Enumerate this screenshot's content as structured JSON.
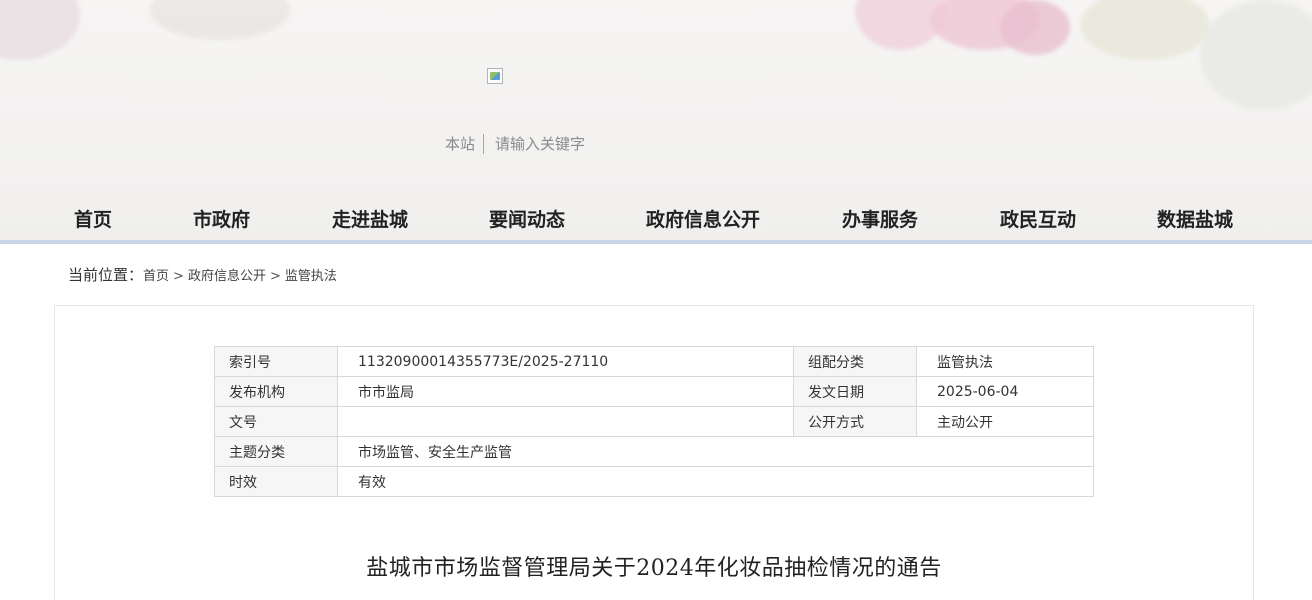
{
  "header": {
    "search_scope": "本站",
    "search_placeholder": "请输入关键字"
  },
  "nav": {
    "items": [
      {
        "label": "首页"
      },
      {
        "label": "市政府"
      },
      {
        "label": "走进盐城"
      },
      {
        "label": "要闻动态"
      },
      {
        "label": "政府信息公开"
      },
      {
        "label": "办事服务"
      },
      {
        "label": "政民互动"
      },
      {
        "label": "数据盐城"
      }
    ]
  },
  "breadcrumb": {
    "label": "当前位置：",
    "items": [
      "首页",
      "政府信息公开",
      "监管执法"
    ],
    "separator": ">"
  },
  "meta": {
    "index_label": "索引号",
    "index_value": "11320900014355773E/2025-27110",
    "category_label": "组配分类",
    "category_value": "监管执法",
    "publisher_label": "发布机构",
    "publisher_value": "市市监局",
    "date_label": "发文日期",
    "date_value": "2025-06-04",
    "docno_label": "文号",
    "docno_value": "",
    "disclosure_label": "公开方式",
    "disclosure_value": "主动公开",
    "topic_label": "主题分类",
    "topic_value": "市场监管、安全生产监管",
    "validity_label": "时效",
    "validity_value": "有效"
  },
  "document": {
    "title": "盐城市市场监督管理局关于2024年化妆品抽检情况的通告"
  }
}
